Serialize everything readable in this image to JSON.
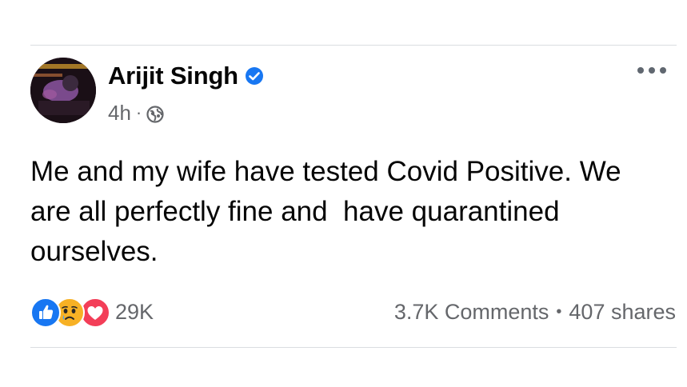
{
  "post": {
    "author": "Arijit Singh",
    "verified": true,
    "time": "4h",
    "time_separator": "·",
    "audience_icon": "globe-icon",
    "text": "Me and my wife have tested Covid Positive. We\nare all perfectly fine and  have quarantined\nourselves."
  },
  "reactions": {
    "icons": [
      "like-icon",
      "sad-icon",
      "love-icon"
    ],
    "count": "29K"
  },
  "engagement": {
    "comments": "3.7K Comments",
    "separator": "•",
    "shares": "407 shares"
  },
  "colors": {
    "verified": "#1877f2",
    "like": "#1877f2",
    "sad": "#f7b125",
    "love": "#f33e58",
    "secondary_text": "#65676b"
  }
}
